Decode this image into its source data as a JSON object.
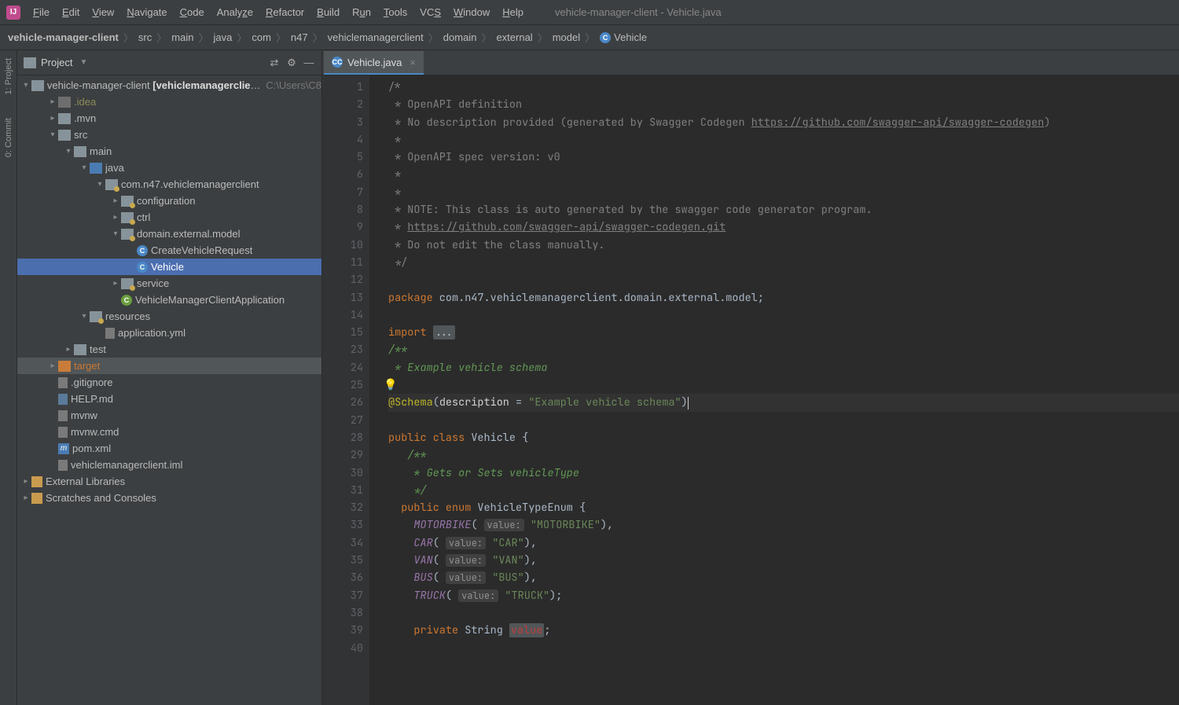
{
  "window_title": "vehicle-manager-client - Vehicle.java",
  "menu": [
    "File",
    "Edit",
    "View",
    "Navigate",
    "Code",
    "Analyze",
    "Refactor",
    "Build",
    "Run",
    "Tools",
    "VCS",
    "Window",
    "Help"
  ],
  "breadcrumbs": [
    "vehicle-manager-client",
    "src",
    "main",
    "java",
    "com",
    "n47",
    "vehiclemanagerclient",
    "domain",
    "external",
    "model",
    "Vehicle"
  ],
  "left_rail": [
    "1: Project",
    "0: Commit"
  ],
  "project_header": {
    "title": "Project"
  },
  "tree": {
    "root_name": "vehicle-manager-client",
    "root_bold": "[vehiclemanagerclient]",
    "root_path": "C:\\Users\\C8",
    "idea": ".idea",
    "mvn": ".mvn",
    "src": "src",
    "main": "main",
    "java": "java",
    "base_pkg": "com.n47.vehiclemanagerclient",
    "configuration": "configuration",
    "ctrl": "ctrl",
    "domain_ext_model": "domain.external.model",
    "create_vehicle_request": "CreateVehicleRequest",
    "vehicle": "Vehicle",
    "service": "service",
    "app_class": "VehicleManagerClientApplication",
    "resources": "resources",
    "application_yml": "application.yml",
    "test": "test",
    "target": "target",
    "gitignore": ".gitignore",
    "help_md": "HELP.md",
    "mvnw": "mvnw",
    "mvnw_cmd": "mvnw.cmd",
    "pom_xml": "pom.xml",
    "iml": "vehiclemanagerclient.iml",
    "ext_libs": "External Libraries",
    "scratches": "Scratches and Consoles"
  },
  "tab": {
    "label": "Vehicle.java"
  },
  "line_numbers": [
    1,
    2,
    3,
    4,
    5,
    6,
    7,
    8,
    9,
    10,
    11,
    12,
    13,
    14,
    15,
    23,
    24,
    25,
    26,
    27,
    28,
    29,
    30,
    31,
    32,
    33,
    34,
    35,
    36,
    37,
    38,
    39,
    40
  ],
  "code": {
    "l1": "/*",
    "l2": " * OpenAPI definition",
    "l3_a": " * No description provided (generated by Swagger Codegen ",
    "l3_link": "https://github.com/swagger-api/swagger-codegen",
    "l3_b": ")",
    "l4": " *",
    "l5": " * OpenAPI spec version: v0",
    "l6": " *",
    "l7": " *",
    "l8": " * NOTE: This class is auto generated by the swagger code generator program.",
    "l9_a": " * ",
    "l9_link": "https://github.com/swagger-api/swagger-codegen.git",
    "l10": " * Do not edit the class manually.",
    "l11": " */",
    "l13_kw": "package",
    "l13_pkg": " com.n47.vehiclemanagerclient.domain.external.model",
    "l15_kw": "import ",
    "l15_dots": "...",
    "l23": "/**",
    "l24": " * Example vehicle schema",
    "l25": "",
    "l26_ann": "@Schema",
    "l26_open": "(",
    "l26_param": "description",
    "l26_eq": " = ",
    "l26_str": "\"Example vehicle schema\"",
    "l26_close": ")",
    "l28_pub": "public ",
    "l28_cls": "class ",
    "l28_name": "Vehicle {",
    "l29": "   /**",
    "l30": "    * Gets or Sets vehicleType",
    "l31": "    */",
    "l32_pub": "  public ",
    "l32_enum": "enum ",
    "l32_name": "VehicleTypeEnum {",
    "hint_value": "value:",
    "enum_motorbike": "MOTORBIKE",
    "str_motorbike": "\"MOTORBIKE\"",
    "enum_car": "CAR",
    "str_car": "\"CAR\"",
    "enum_van": "VAN",
    "str_van": "\"VAN\"",
    "enum_bus": "BUS",
    "str_bus": "\"BUS\"",
    "enum_truck": "TRUCK",
    "str_truck": "\"TRUCK\"",
    "l39_priv": "    private ",
    "l39_type": "String ",
    "l39_name": "value",
    "semicolon": ";",
    "comma_close": "),",
    "paren_close_semi": ");"
  },
  "chart_data": null
}
